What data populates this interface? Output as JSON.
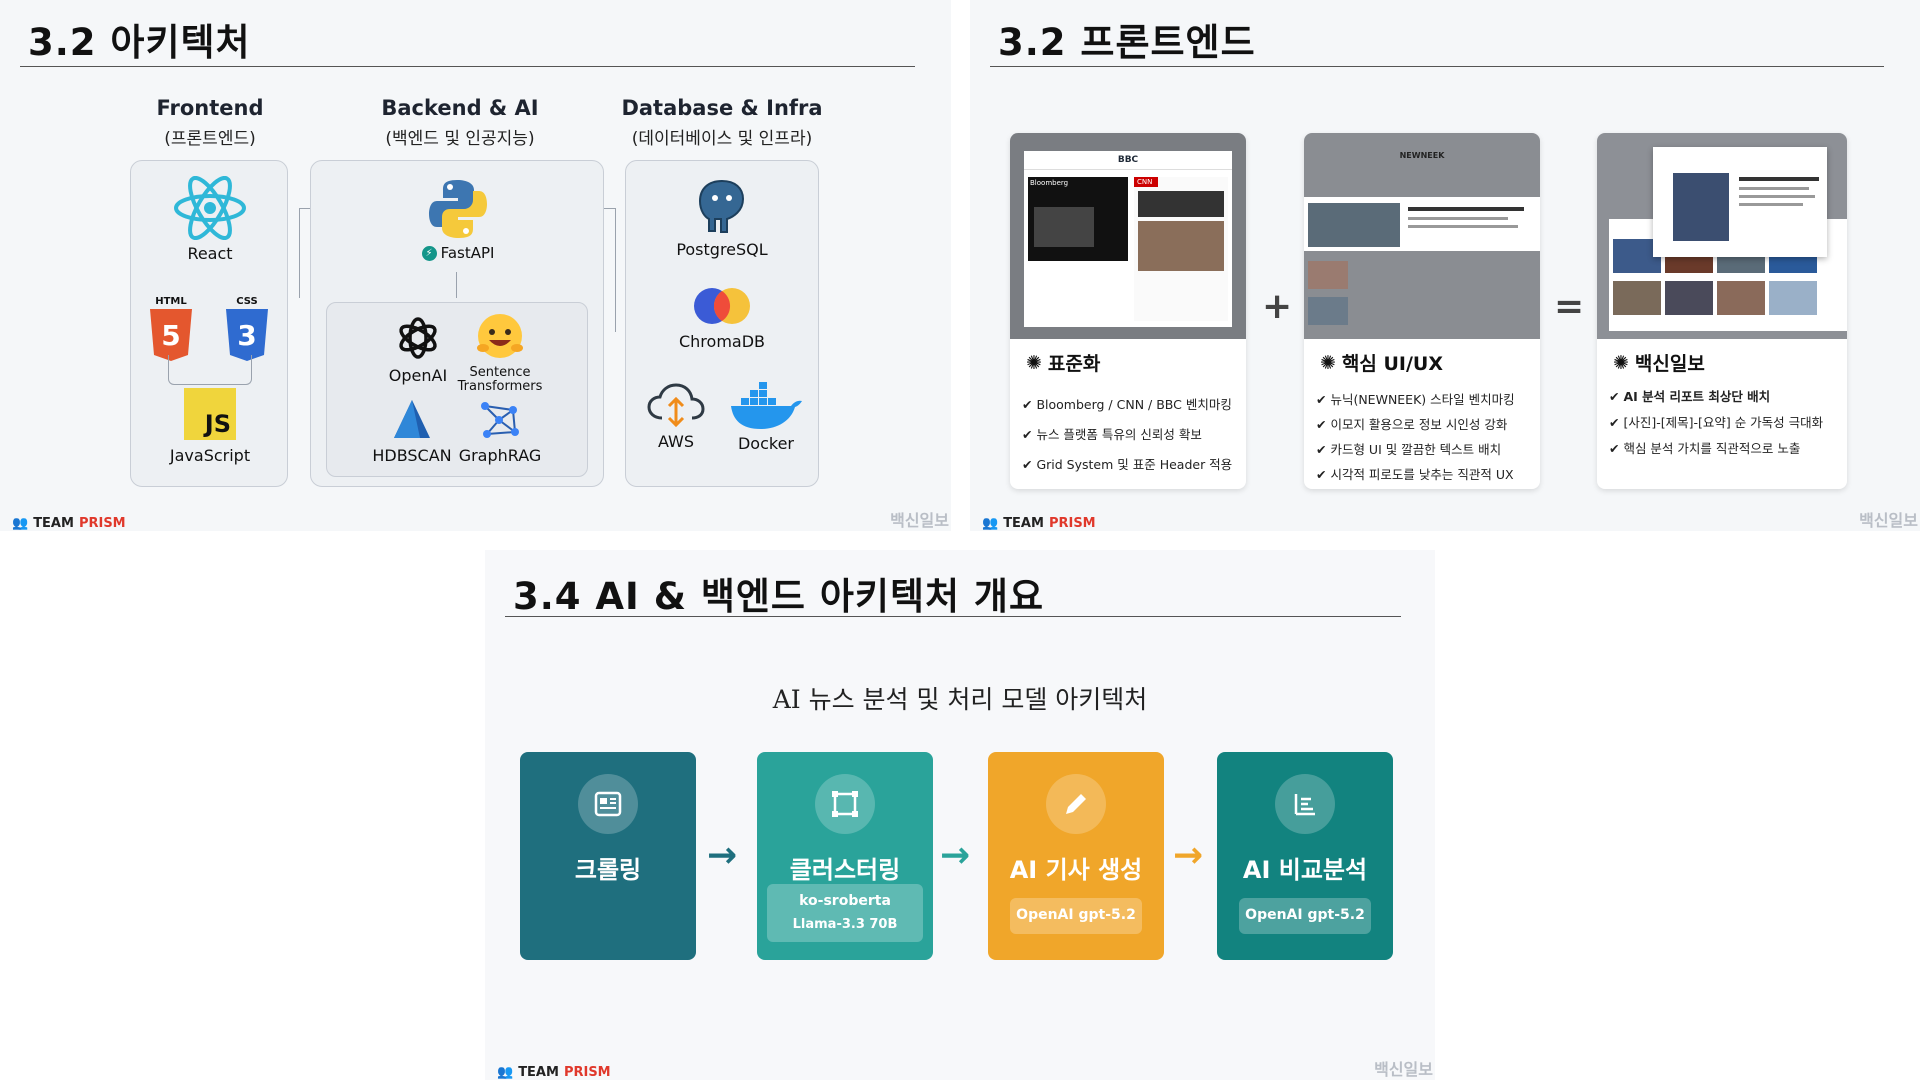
{
  "slide1": {
    "title": "3.2 아키텍처",
    "columns": [
      {
        "name": "Frontend",
        "sub": "(프론트엔드)"
      },
      {
        "name": "Backend & AI",
        "sub": "(백엔드 및 인공지능)"
      },
      {
        "name": "Database & Infra",
        "sub": "(데이터베이스 및 인프라)"
      }
    ],
    "frontend": {
      "react": "React",
      "html_badge": "HTML",
      "css_badge": "CSS",
      "js_glyph": "JS",
      "javascript": "JavaScript"
    },
    "backend": {
      "fastapi": "FastAPI",
      "openai": "OpenAI",
      "sentence": "Sentence Transformers",
      "hdbscan": "HDBSCAN",
      "graphrag": "GraphRAG"
    },
    "infra": {
      "postgres": "PostgreSQL",
      "chroma": "ChromaDB",
      "aws": "AWS",
      "docker": "Docker"
    },
    "team": {
      "prefix": "TEAM ",
      "brand": "PRISM"
    },
    "watermark": "백신일보"
  },
  "slide2": {
    "title": "3.2 프론트엔드",
    "cards": [
      {
        "title": "표준화",
        "bullets": [
          "Bloomberg / CNN / BBC 벤치마킹",
          "뉴스 플랫폼 특유의 신뢰성 확보",
          "Grid System 및 표준 Header 적용"
        ]
      },
      {
        "title": "핵심 UI/UX",
        "bullets": [
          "뉴닉(NEWNEEK) 스타일 벤치마킹",
          "이모지 활용으로 정보 시인성 강화",
          "카드형 UI 및 깔끔한 텍스트 배치",
          "시각적 피로도를 낮추는 직관적 UX"
        ]
      },
      {
        "title": "백신일보",
        "bullets": [
          "AI 분석 리포트 최상단 배치",
          "[사진]-[제목]-[요약] 순 가독성 극대화",
          "핵심 분석 가치를 직관적으로 노출"
        ]
      }
    ],
    "plus": "+",
    "equals": "=",
    "shots": {
      "bbc": "BBC",
      "bloomberg": "Bloomberg",
      "cnn": "CNN",
      "newneek": "NEWNEEK"
    },
    "team": {
      "prefix": "TEAM ",
      "brand": "PRISM"
    },
    "watermark": "백신일보"
  },
  "slide3": {
    "title": "3.4 AI & 백엔드 아키텍처 개요",
    "subtitle": "AI 뉴스 분석 및 처리 모델 아키텍처",
    "steps": [
      {
        "label": "크롤링",
        "color": "#1f6f7e"
      },
      {
        "label": "클러스터링",
        "tag1": "ko-sroberta",
        "tag2": "Llama-3.3  70B",
        "color": "#2aa39a"
      },
      {
        "label": "AI 기사 생성",
        "tag1": "OpenAI  gpt-5.2",
        "color": "#f0a62a"
      },
      {
        "label": "AI 비교분석",
        "tag1": "OpenAI  gpt-5.2",
        "color": "#12837f"
      }
    ],
    "arrows": [
      "→",
      "→",
      "→"
    ],
    "arrow_colors": [
      "#1f6f7e",
      "#2aa39a",
      "#f0a62a"
    ],
    "team": {
      "prefix": "TEAM ",
      "brand": "PRISM"
    },
    "watermark": "백신일보"
  }
}
